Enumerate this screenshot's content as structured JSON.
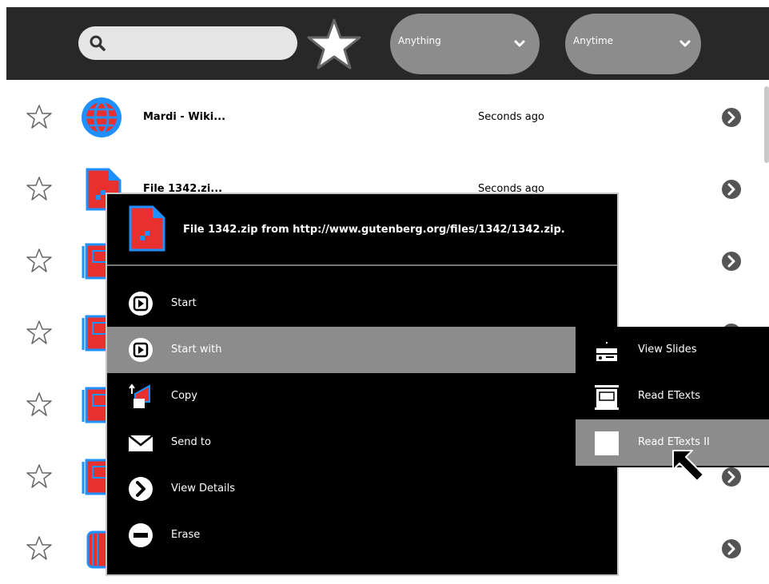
{
  "toolbar": {
    "search": {
      "value": "",
      "icon": "search-icon"
    },
    "favorites_icon": "star-icon",
    "filter_what": {
      "label": "Anything",
      "icon": "chevron-down-icon"
    },
    "filter_when": {
      "label": "Anytime",
      "icon": "chevron-down-icon"
    }
  },
  "journal": {
    "rows": [
      {
        "title": "Mardi - Wiki...",
        "time": "Seconds ago",
        "icon": "browse-activity-icon"
      },
      {
        "title": "File 1342.zi...",
        "time": "Seconds ago",
        "icon": "zip-file-icon"
      },
      {
        "title": "",
        "time": "",
        "icon": "etexts-activity-icon"
      },
      {
        "title": "",
        "time": "",
        "icon": "etexts-activity-icon"
      },
      {
        "title": "",
        "time": "",
        "icon": "etexts-activity-icon"
      },
      {
        "title": "",
        "time": "",
        "icon": "etexts-activity-icon"
      },
      {
        "title": "",
        "time": "",
        "icon": "notebook-activity-icon"
      }
    ]
  },
  "palette": {
    "title": "File 1342.zip from http://www.gutenberg.org/files/1342/1342.zip.",
    "items": [
      {
        "label": "Start",
        "icon": "play-icon"
      },
      {
        "label": "Start with",
        "icon": "play-icon"
      },
      {
        "label": "Copy",
        "icon": "copy-icon"
      },
      {
        "label": "Send to",
        "icon": "envelope-icon"
      },
      {
        "label": "View Details",
        "icon": "chevron-right-icon"
      },
      {
        "label": "Erase",
        "icon": "erase-icon"
      }
    ]
  },
  "submenu": {
    "items": [
      {
        "label": "View Slides",
        "icon": "slides-icon"
      },
      {
        "label": "Read ETexts",
        "icon": "etexts-icon"
      },
      {
        "label": "Read ETexts II",
        "icon": "blank-icon"
      }
    ]
  },
  "colors": {
    "toolbar_bg": "#282828",
    "palette_bg": "#000000",
    "highlight": "#8c8c8c",
    "icon_fill": "#e8312f",
    "icon_stroke": "#1e90ff"
  }
}
